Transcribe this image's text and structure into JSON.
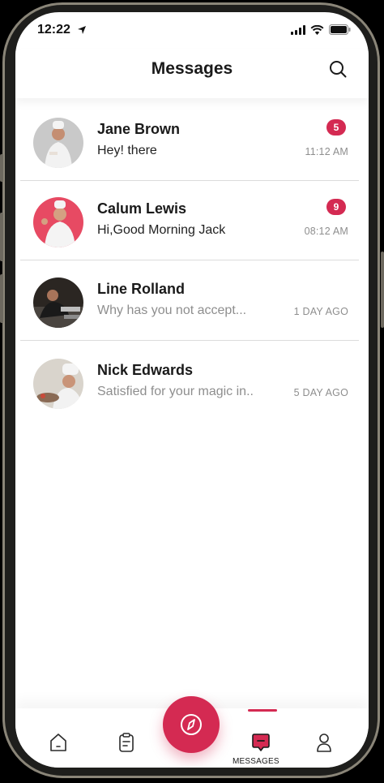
{
  "status": {
    "time": "12:22"
  },
  "header": {
    "title": "Messages"
  },
  "conversations": [
    {
      "name": "Jane Brown",
      "preview": "Hey! there",
      "time": "11:12 AM",
      "unread": "5",
      "muted": false
    },
    {
      "name": "Calum Lewis",
      "preview": "Hi,Good Morning Jack",
      "time": "08:12 AM",
      "unread": "9",
      "muted": false
    },
    {
      "name": "Line Rolland",
      "preview": "Why has you not accept...",
      "time": "1 DAY AGO",
      "unread": "",
      "muted": true
    },
    {
      "name": "Nick Edwards",
      "preview": "Satisfied for your magic in..",
      "time": "5 DAY AGO",
      "unread": "",
      "muted": true
    }
  ],
  "tabbar": {
    "active_label": "MESSAGES"
  },
  "colors": {
    "accent": "#d42a52",
    "muted_text": "#8e8e8e"
  },
  "icons": [
    "search-icon",
    "home-icon",
    "clipboard-icon",
    "compass-icon",
    "message-icon",
    "user-icon"
  ]
}
